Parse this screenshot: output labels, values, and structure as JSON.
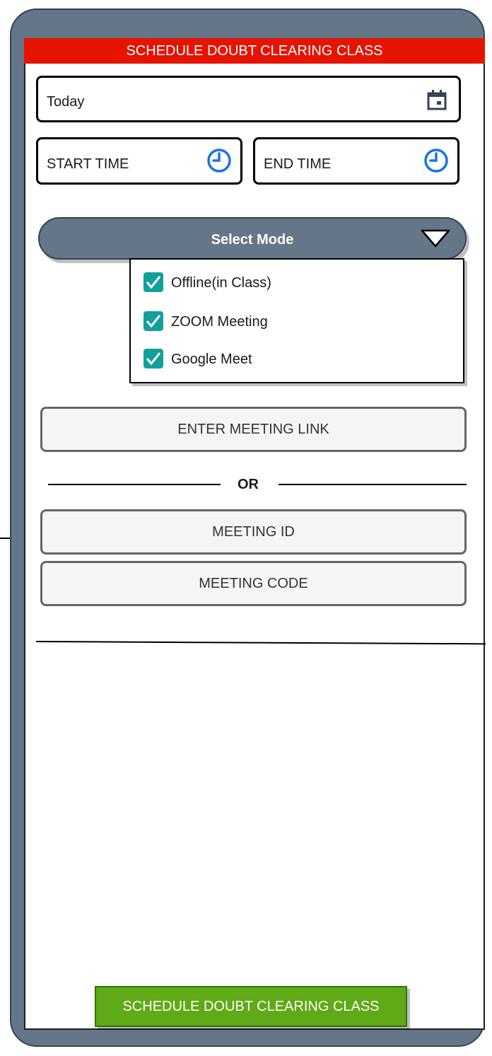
{
  "header": {
    "title": "SCHEDULE DOUBT CLEARING CLASS"
  },
  "date_field": {
    "value": "Today",
    "icon": "calendar-icon"
  },
  "start_time": {
    "label": "START TIME",
    "icon": "clock-icon"
  },
  "end_time": {
    "label": "END TIME",
    "icon": "clock-icon"
  },
  "mode_select": {
    "label": "Select Mode",
    "options": [
      {
        "label": "Offline(in Class)",
        "checked": true
      },
      {
        "label": "ZOOM Meeting",
        "checked": true
      },
      {
        "label": "Google Meet",
        "checked": true
      }
    ]
  },
  "meeting_link": {
    "placeholder": "ENTER MEETING LINK"
  },
  "separator": {
    "text": "OR"
  },
  "meeting_id": {
    "placeholder": "MEETING ID"
  },
  "meeting_code": {
    "placeholder": "MEETING CODE"
  },
  "submit": {
    "label": "SCHEDULE DOUBT CLEARING CLASS"
  },
  "colors": {
    "header_bg": "#e51400",
    "device_frame": "#647687",
    "checkbox": "#13a09a",
    "clock_icon": "#1a73e8",
    "submit_bg": "#60a917"
  }
}
